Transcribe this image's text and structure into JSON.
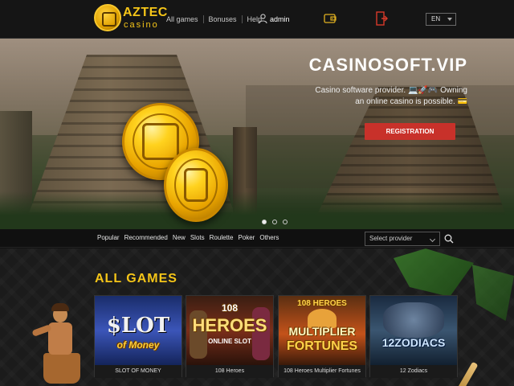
{
  "header": {
    "brand": "AZTEC",
    "brand_sub": "casino",
    "nav": [
      "All games",
      "Bonuses",
      "Help"
    ],
    "username": "admin",
    "language": "EN"
  },
  "hero": {
    "title": "CASINOSOFT.VIP",
    "text": "Casino software provider. 💻🚀🎮 Owning an online casino is possible. 💳",
    "button": "REGISTRATION",
    "slides": 3,
    "active_slide": 1
  },
  "filters": {
    "categories": [
      "Popular",
      "Recommended",
      "New",
      "Slots",
      "Roulette",
      "Poker",
      "Others"
    ],
    "provider_placeholder": "Select provider"
  },
  "games": {
    "title": "ALL GAMES",
    "items": [
      {
        "name": "SLOT OF MONEY",
        "art_line1": "$LOT",
        "art_line2": "of Money"
      },
      {
        "name": "108 Heroes",
        "art_line0": "108",
        "art_line1": "HEROES",
        "art_line2": "ONLINE SLOT"
      },
      {
        "name": "108 Heroes Multiplier Fortunes",
        "art_line0": "108 HEROES",
        "art_line1": "MULTIPLIER",
        "art_line2": "FORTUNES"
      },
      {
        "name": "12 Zodiacs",
        "art_line1": "12ZODIACS"
      }
    ]
  },
  "colors": {
    "accent": "#f5c518",
    "button": "#c8312a",
    "header_bg": "#151515"
  }
}
